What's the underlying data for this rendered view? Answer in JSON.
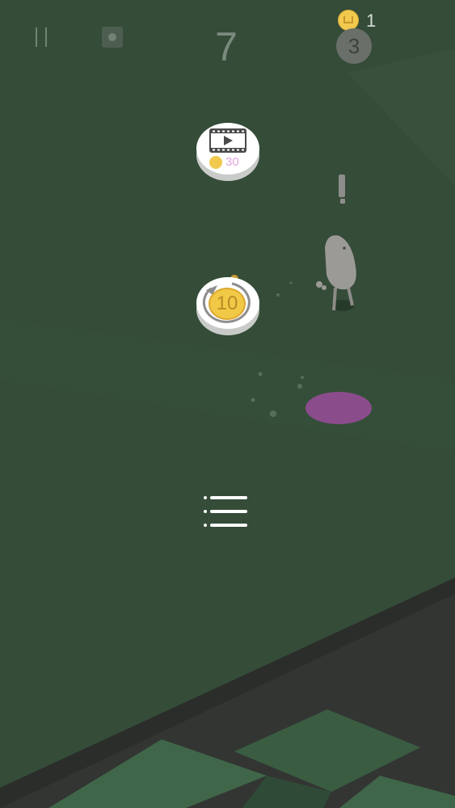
{
  "hud": {
    "score": "7",
    "coins": "1",
    "level": "3",
    "pause_icon": "pause-icon",
    "camera_icon": "camera-icon"
  },
  "actions": {
    "video_icon": "film-play-icon",
    "video_cost": "30",
    "continue_icon": "refresh-icon",
    "continue_cost": "10",
    "menu_icon": "hamburger-icon"
  },
  "colors": {
    "background": "#344c38",
    "coin": "#f1c94f",
    "cost_text": "#e3a6e0",
    "target_pad": "#8b4c8c",
    "character": "#9c9a97"
  }
}
